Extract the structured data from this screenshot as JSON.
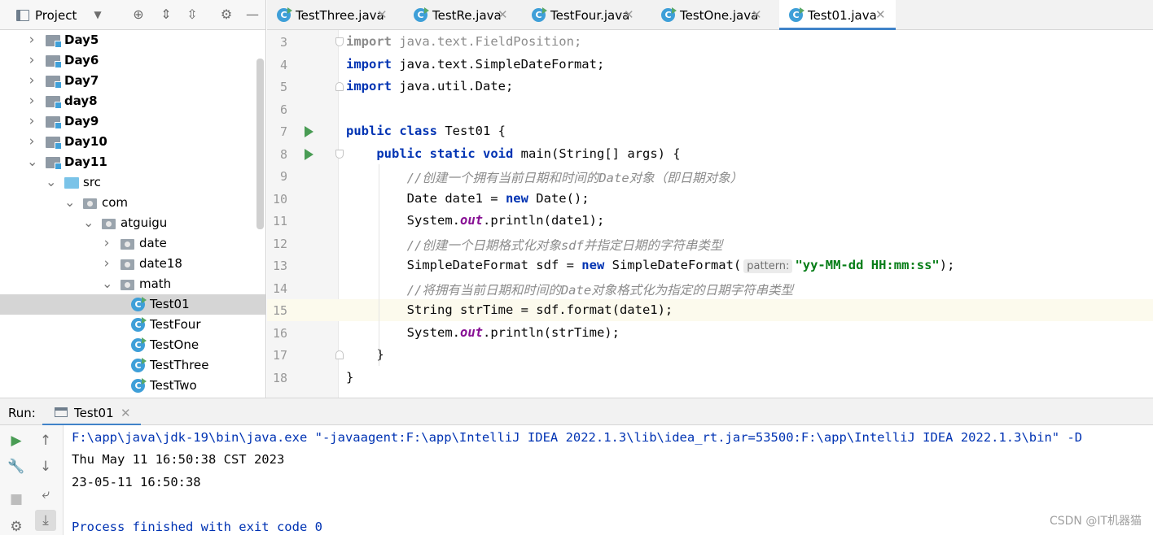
{
  "project": {
    "title": "Project",
    "tree": [
      {
        "label": "Day5",
        "bold": true,
        "icon": "module-icon",
        "expanded": false
      },
      {
        "label": "Day6",
        "bold": true,
        "icon": "module-icon",
        "expanded": false
      },
      {
        "label": "Day7",
        "bold": true,
        "icon": "module-icon",
        "expanded": false
      },
      {
        "label": "day8",
        "bold": true,
        "icon": "module-icon",
        "expanded": false
      },
      {
        "label": "Day9",
        "bold": true,
        "icon": "module-icon",
        "expanded": false
      },
      {
        "label": "Day10",
        "bold": true,
        "icon": "module-icon",
        "expanded": false
      },
      {
        "label": "Day11",
        "bold": true,
        "icon": "module-icon",
        "expanded": true
      },
      {
        "label": "src",
        "icon": "source-folder-icon",
        "expanded": true
      },
      {
        "label": "com",
        "icon": "package-icon",
        "expanded": true
      },
      {
        "label": "atguigu",
        "icon": "package-icon",
        "expanded": true
      },
      {
        "label": "date",
        "icon": "package-icon",
        "expanded": false
      },
      {
        "label": "date18",
        "icon": "package-icon",
        "expanded": false
      },
      {
        "label": "math",
        "icon": "package-icon",
        "expanded": true
      },
      {
        "label": "Test01",
        "icon": "java-class-icon",
        "selected": true
      },
      {
        "label": "TestFour",
        "icon": "java-class-icon"
      },
      {
        "label": "TestOne",
        "icon": "java-class-icon"
      },
      {
        "label": "TestThree",
        "icon": "java-class-icon"
      },
      {
        "label": "TestTwo",
        "icon": "java-class-icon"
      }
    ]
  },
  "tabs": [
    {
      "label": "TestThree.java",
      "active": false
    },
    {
      "label": "TestRe.java",
      "active": false
    },
    {
      "label": "TestFour.java",
      "active": false
    },
    {
      "label": "TestOne.java",
      "active": false
    },
    {
      "label": "Test01.java",
      "active": true
    }
  ],
  "editor": {
    "current_line": "15",
    "lines": [
      {
        "num": "3",
        "run": false,
        "fold": "start"
      },
      {
        "num": "4",
        "run": false
      },
      {
        "num": "5",
        "run": false,
        "fold": "end"
      },
      {
        "num": "6",
        "run": false
      },
      {
        "num": "7",
        "run": true
      },
      {
        "num": "8",
        "run": true,
        "fold": "start"
      },
      {
        "num": "9"
      },
      {
        "num": "10"
      },
      {
        "num": "11"
      },
      {
        "num": "12"
      },
      {
        "num": "13"
      },
      {
        "num": "14"
      },
      {
        "num": "15"
      },
      {
        "num": "16"
      },
      {
        "num": "17",
        "fold": "end"
      },
      {
        "num": "18"
      }
    ],
    "code": {
      "l3_kw": "import",
      "l3_rest": " java.text.FieldPosition;",
      "l4_kw": "import",
      "l4_rest": " java.text.SimpleDateFormat;",
      "l5_kw": "import",
      "l5_rest": " java.util.Date;",
      "l7_kw1": "public",
      "l7_kw2": "class",
      "l7_rest": " Test01 {",
      "l8_kw1": "public",
      "l8_kw2": "static",
      "l8_kw3": "void",
      "l8_rest": " main(String[] args) {",
      "l9_comment": "//创建一个拥有当前日期和时间的Date对象（即日期对象）",
      "l10_a": "Date date1 = ",
      "l10_kw": "new",
      "l10_b": " Date();",
      "l11_a": "System.",
      "l11_field": "out",
      "l11_b": ".println(date1);",
      "l12_comment": "//创建一个日期格式化对象sdf并指定日期的字符串类型",
      "l13_a": "SimpleDateFormat sdf = ",
      "l13_kw": "new",
      "l13_b": " SimpleDateFormat(",
      "l13_hint": "pattern:",
      "l13_str": "\"yy-MM-dd HH:mm:ss\"",
      "l13_c": ");",
      "l14_comment": "//将拥有当前日期和时间的Date对象格式化为指定的日期字符串类型",
      "l15_a": "String strTime = sdf.format(date1);",
      "l16_a": "System.",
      "l16_field": "out",
      "l16_b": ".println(strTime);",
      "l17_a": "}",
      "l18_a": "}"
    }
  },
  "run": {
    "label": "Run:",
    "tab_label": "Test01",
    "console": {
      "command": "F:\\app\\java\\jdk-19\\bin\\java.exe \"-javaagent:F:\\app\\IntelliJ IDEA 2022.1.3\\lib\\idea_rt.jar=53500:F:\\app\\IntelliJ IDEA 2022.1.3\\bin\" -D",
      "output1": "Thu May 11 16:50:38 CST 2023",
      "output2": "23-05-11 16:50:38",
      "finish": "Process finished with exit code 0"
    }
  },
  "watermark": "CSDN @IT机器猫",
  "colors": {
    "keyword": "#0033b3",
    "string": "#067d17",
    "comment": "#8c8c8c",
    "static_field": "#871094",
    "run_green": "#499c54",
    "tab_underline": "#4083c9",
    "current_line_bg": "#fcfaed"
  }
}
